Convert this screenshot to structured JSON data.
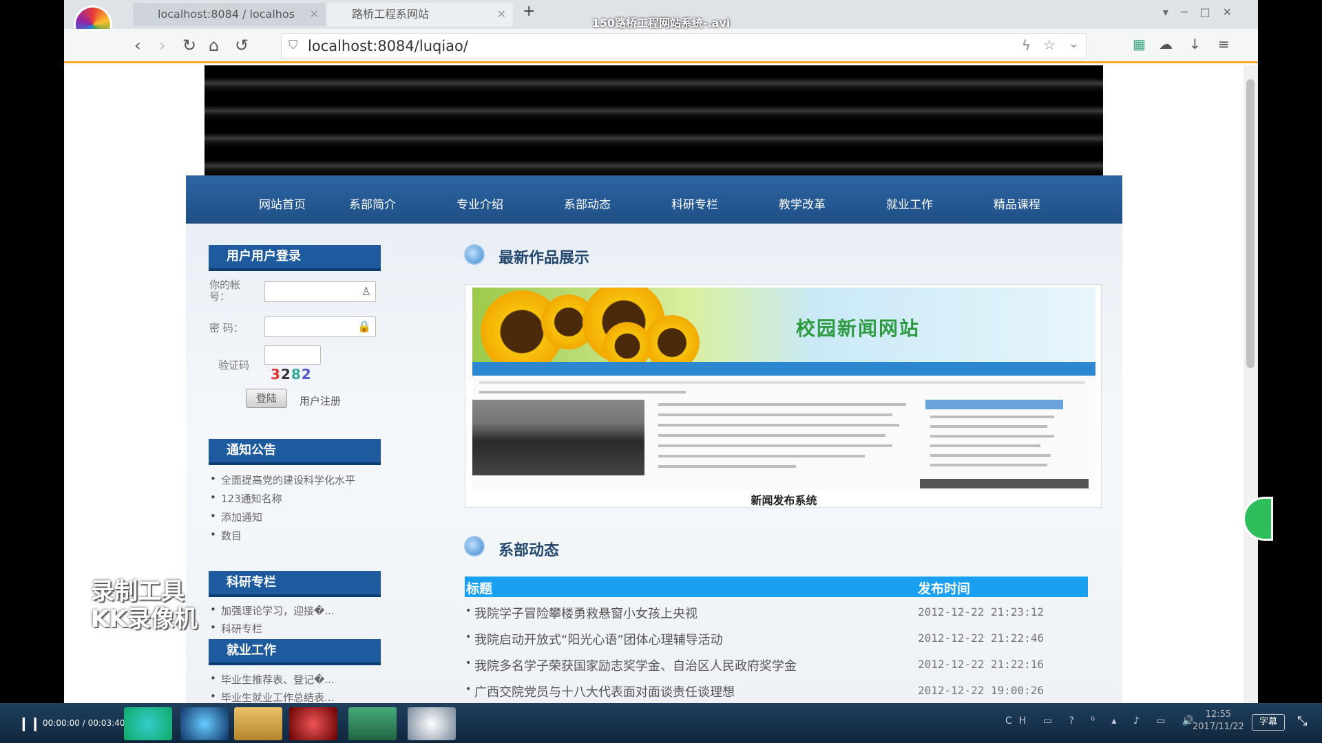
{
  "player": {
    "window_title": "150路桥工程网站系统-.avi",
    "time": "00:00:00 / 00:03:40",
    "subtitle_button": "字幕",
    "clock_time": "12:55",
    "clock_date": "2017/11/22",
    "tray_lang": "CH"
  },
  "browser": {
    "tabs": [
      {
        "label": "localhost:8084 / localhos"
      },
      {
        "label": "路桥工程系网站"
      }
    ],
    "url": "localhost:8084/luqiao/"
  },
  "site": {
    "menu": [
      "网站首页",
      "系部简介",
      "专业介绍",
      "系部动态",
      "科研专栏",
      "教学改革",
      "就业工作",
      "精品课程"
    ],
    "login": {
      "title": "用户用户登录",
      "account_label": "你的帐号：",
      "password_label": "密  码：",
      "captcha_label": "验证码",
      "captcha_value": "3282",
      "login_button": "登陆",
      "register_link": "用户注册"
    },
    "notice": {
      "title": "通知公告",
      "items": [
        "全面提高党的建设科学化水平",
        "123通知名称",
        "添加通知",
        "数目"
      ]
    },
    "research": {
      "title": "科研专栏",
      "items": [
        "加强理论学习，迎接�...",
        "科研专栏"
      ]
    },
    "jobs": {
      "title": "就业工作",
      "items": [
        "毕业生推荐表、登记�...",
        "毕业生就业工作总结表..."
      ]
    },
    "showcase": {
      "title": "最新作品展示",
      "image_title": "校园新闻网站",
      "caption": "新闻发布系统"
    },
    "news": {
      "title": "系部动态",
      "col_title": "标题",
      "col_time": "发布时间",
      "rows": [
        {
          "title": "我院学子冒险攀楼勇救悬窗小女孩上央视",
          "time": "2012-12-22 21:23:12"
        },
        {
          "title": "我院启动开放式“阳光心语”团体心理辅导活动",
          "time": "2012-12-22 21:22:46"
        },
        {
          "title": "我院多名学子荣获国家励志奖学金、自治区人民政府奖学金",
          "time": "2012-12-22 21:22:16"
        },
        {
          "title": "广西交院党员与十八大代表面对面谈责任谈理想",
          "time": "2012-12-22 19:00:26"
        }
      ]
    }
  },
  "watermark": [
    "录制工具",
    "KK录像机"
  ]
}
